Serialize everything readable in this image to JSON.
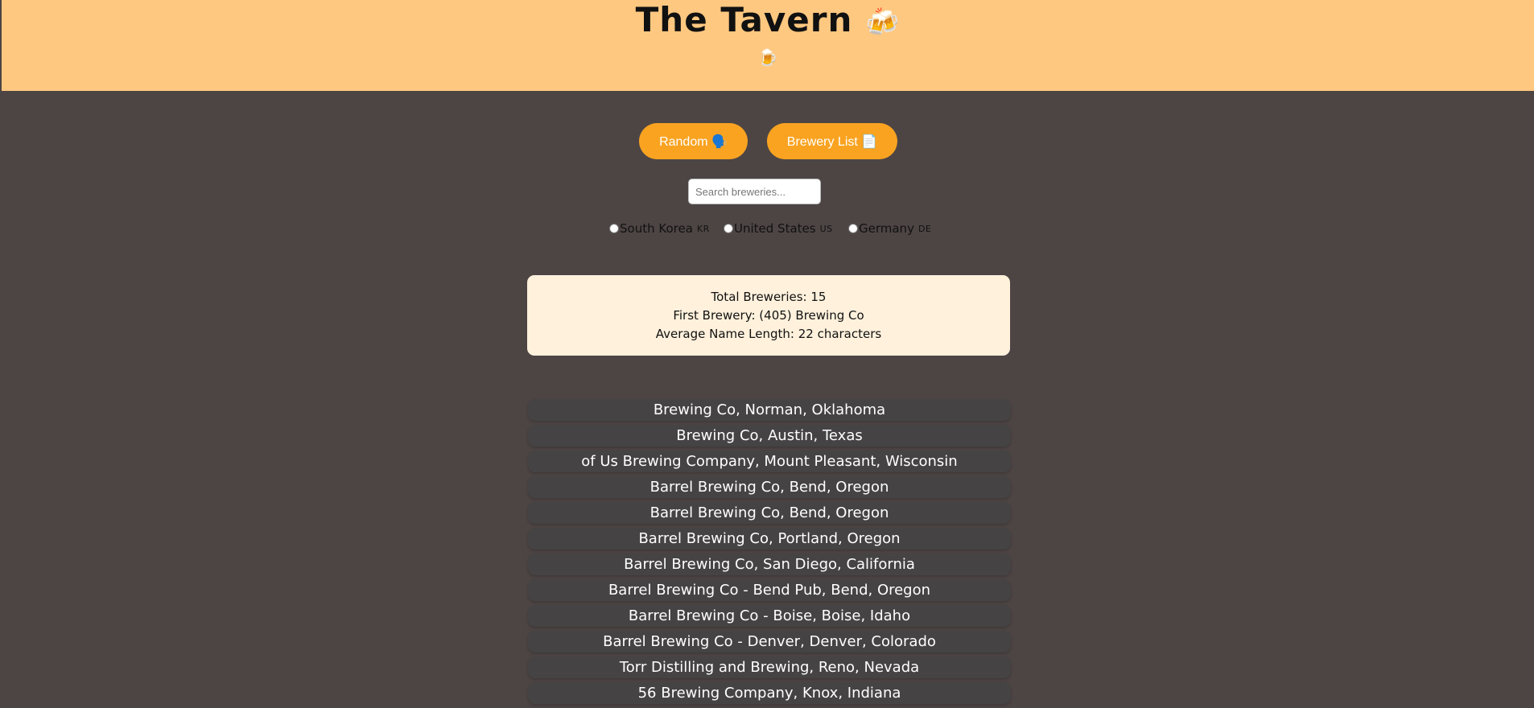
{
  "header": {
    "title": "The Tavern",
    "title_icon": "🍻",
    "subtitle_icon": "🍺",
    "background": "#ffc880"
  },
  "actions": {
    "random_label": "Random 🗣️",
    "list_label": "Brewery List 📄",
    "accent": "#f9a321"
  },
  "search": {
    "placeholder": "Search breweries..."
  },
  "countries": [
    {
      "label": "South Korea",
      "flag": "KR"
    },
    {
      "label": "United States",
      "flag": "US"
    },
    {
      "label": "Germany",
      "flag": "DE"
    }
  ],
  "stats": {
    "total": "Total Breweries: 15",
    "first": "First Brewery: (405) Brewing Co",
    "average": "Average Name Length: 22 characters"
  },
  "breweries": [
    "Brewing Co, Norman, Oklahoma",
    "Brewing Co, Austin, Texas",
    "of Us Brewing Company, Mount Pleasant, Wisconsin",
    "Barrel Brewing Co, Bend, Oregon",
    "Barrel Brewing Co, Bend, Oregon",
    "Barrel Brewing Co, Portland, Oregon",
    "Barrel Brewing Co, San Diego, California",
    "Barrel Brewing Co - Bend Pub, Bend, Oregon",
    "Barrel Brewing Co - Boise, Boise, Idaho",
    "Barrel Brewing Co - Denver, Denver, Colorado",
    "Torr Distilling and Brewing, Reno, Nevada",
    "56 Brewing Company, Knox, Indiana"
  ],
  "colors": {
    "page_background": "#4d4544",
    "card_background": "#fff1dc",
    "list_item_background": "#454343"
  }
}
